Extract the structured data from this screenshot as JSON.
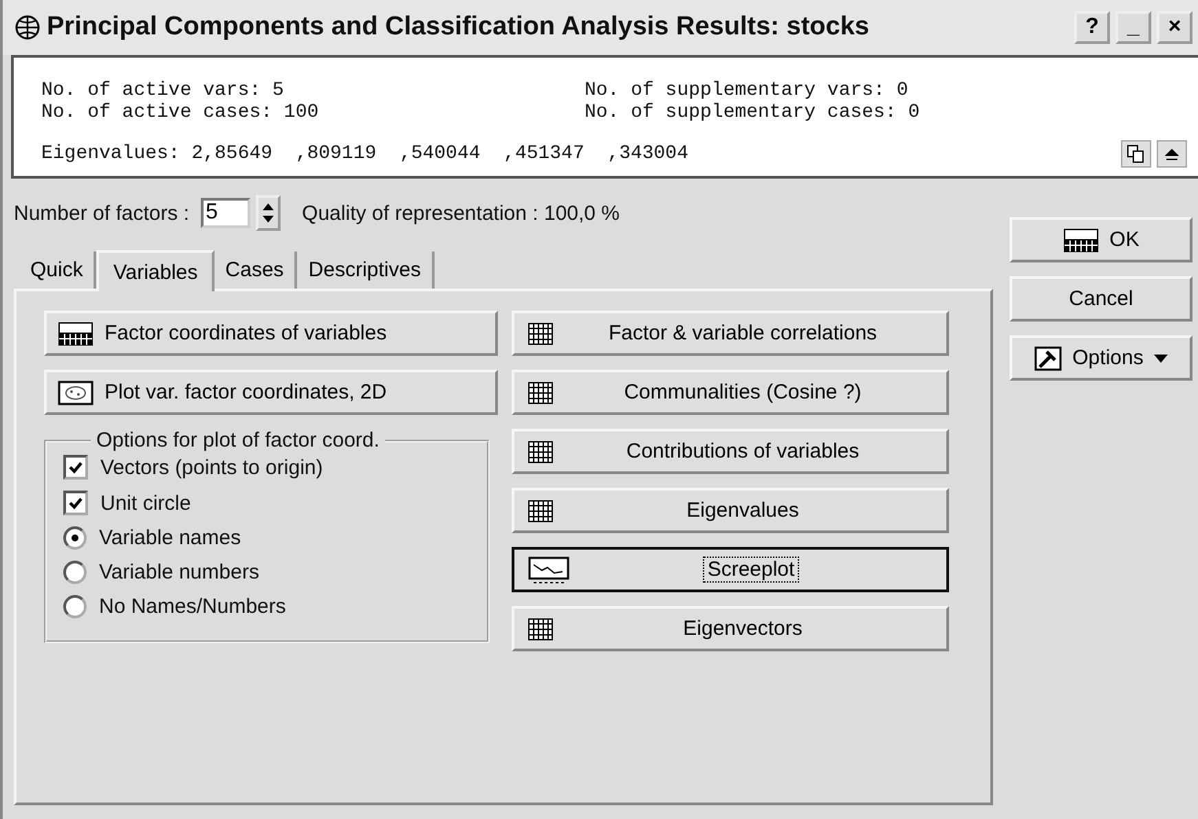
{
  "window": {
    "title": "Principal Components and Classification Analysis Results: stocks",
    "controls": [
      "?",
      "_",
      "×"
    ]
  },
  "summary": {
    "rows": [
      [
        "No. of active vars: 5",
        "No. of supplementary vars: 0"
      ],
      [
        "No. of active cases: 100",
        "No. of supplementary cases: 0"
      ]
    ],
    "eigenvalues": "Eigenvalues: 2,85649  ,809119  ,540044  ,451347  ,343004"
  },
  "factors": {
    "label": "Number of factors :",
    "value": "5",
    "quality": "Quality of representation : 100,0  %"
  },
  "tabs": [
    {
      "label": "Quick",
      "selected": false
    },
    {
      "label": "Variables",
      "selected": true
    },
    {
      "label": "Cases",
      "selected": false
    },
    {
      "label": "Descriptives",
      "selected": false
    }
  ],
  "left_buttons": [
    {
      "label": "Factor coordinates of variables",
      "kind": "summary"
    },
    {
      "label": "Plot var. factor coordinates, 2D",
      "kind": "scatter"
    }
  ],
  "options_group": {
    "title": "Options for plot of factor coord.",
    "items": [
      {
        "kind": "checkbox",
        "label": "Vectors (points to origin)",
        "checked": true
      },
      {
        "kind": "checkbox",
        "label": "Unit circle",
        "checked": true
      },
      {
        "kind": "radio",
        "label": "Variable names",
        "selected": true
      },
      {
        "kind": "radio",
        "label": "Variable numbers",
        "selected": false
      },
      {
        "kind": "radio",
        "label": "No Names/Numbers",
        "selected": false
      }
    ]
  },
  "right_buttons": [
    {
      "label": "Factor & variable correlations",
      "kind": "grid",
      "focused": false
    },
    {
      "label": "Communalities (Cosine ?)",
      "kind": "grid",
      "focused": false
    },
    {
      "label": "Contributions of variables",
      "kind": "grid",
      "focused": false
    },
    {
      "label": "Eigenvalues",
      "kind": "grid",
      "focused": false
    },
    {
      "label": "Screeplot",
      "kind": "line",
      "focused": true
    },
    {
      "label": "Eigenvectors",
      "kind": "grid",
      "focused": false
    }
  ],
  "side_buttons": [
    {
      "label": "OK",
      "kind": "summary",
      "menu": false
    },
    {
      "label": "Cancel",
      "kind": "plain",
      "menu": false
    },
    {
      "label": "Options",
      "kind": "tool",
      "menu": true
    }
  ]
}
